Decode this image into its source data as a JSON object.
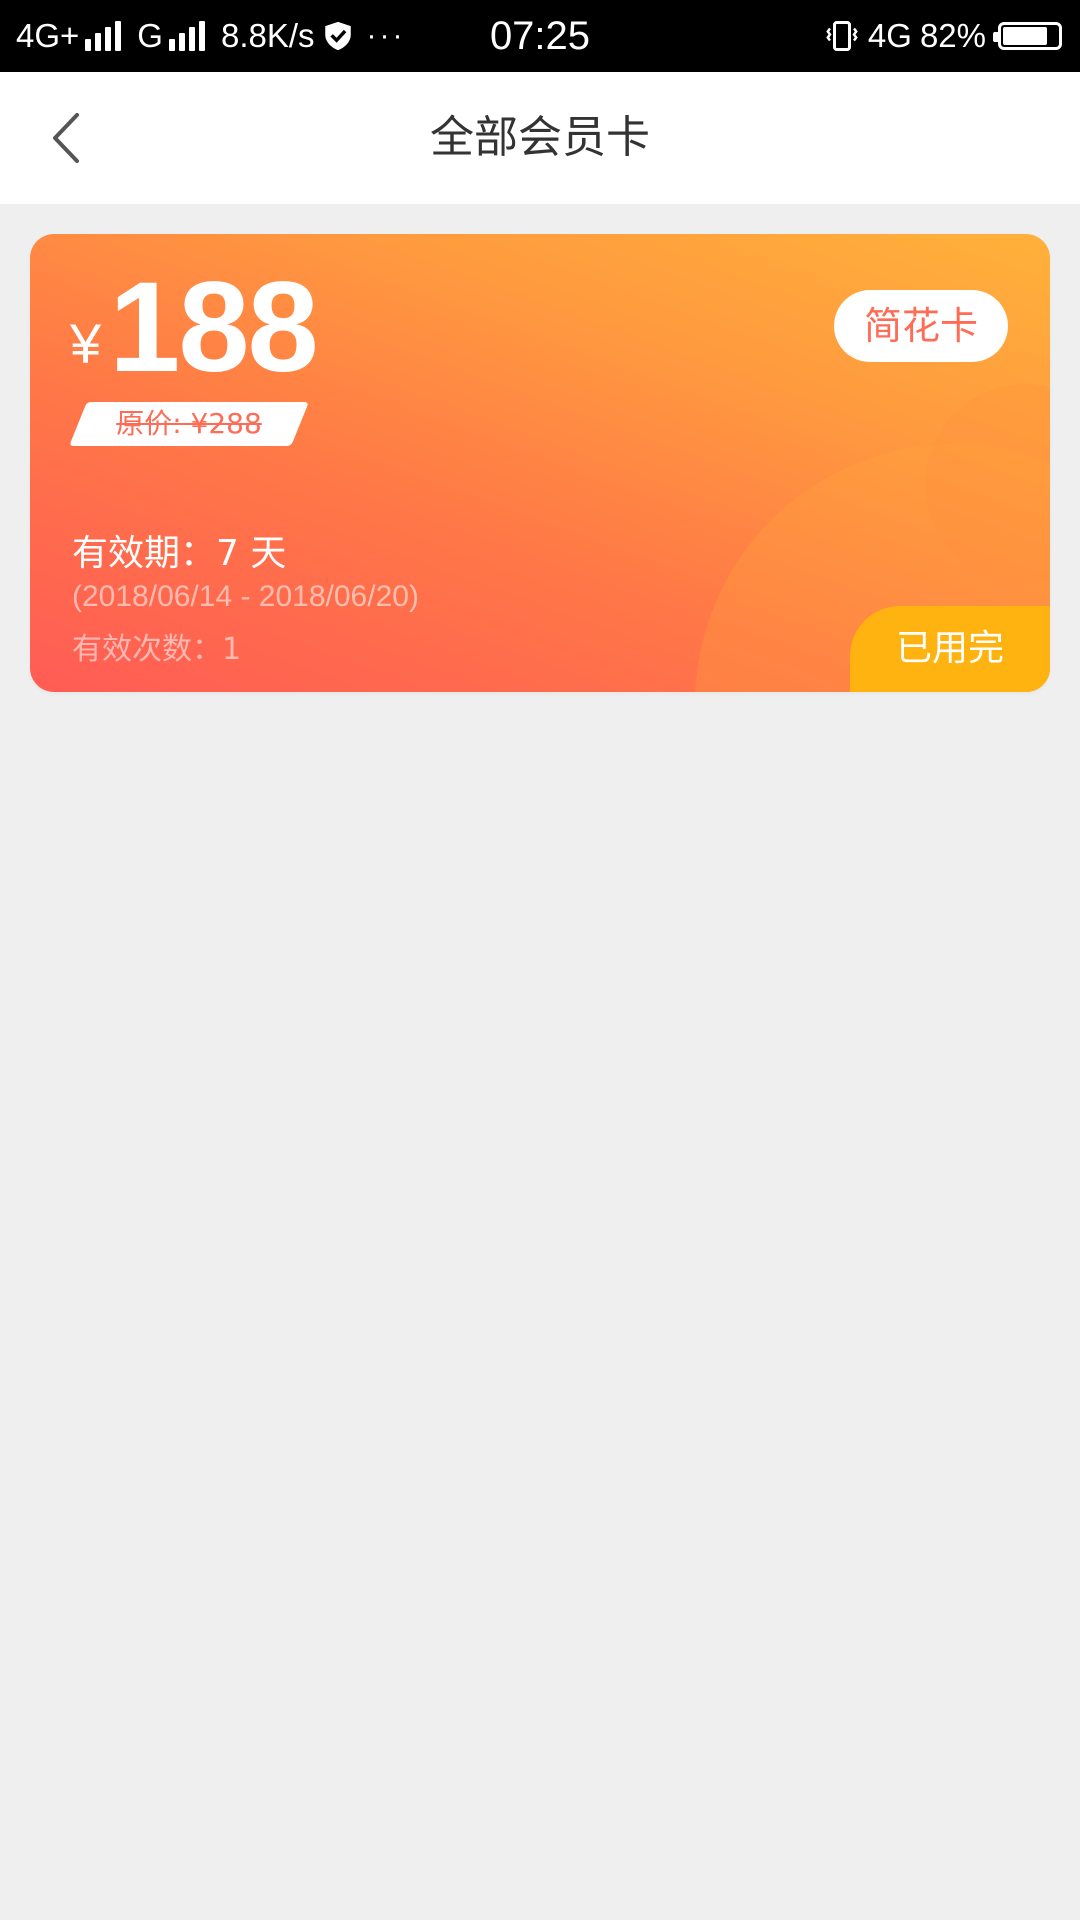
{
  "status_bar": {
    "network_left": "4G+",
    "network_second": "G",
    "speed": "8.8K/s",
    "more": "···",
    "time": "07:25",
    "network_right": "4G",
    "battery_percent": "82%",
    "battery_level": 0.82
  },
  "header": {
    "title": "全部会员卡",
    "back_icon": "chevron-left-icon"
  },
  "card": {
    "currency": "¥",
    "price": "188",
    "original_price": "原价: ¥288",
    "brand": "简花卡",
    "validity": "有效期：7 天",
    "date_range": "(2018/06/14 - 2018/06/20)",
    "valid_times": "有效次数：1",
    "status": "已用完",
    "colors": {
      "gradient_top": "#ffb13a",
      "gradient_bottom": "#ff5c55",
      "status_badge": "#ffb310",
      "brand_text": "#ff6b55"
    }
  }
}
